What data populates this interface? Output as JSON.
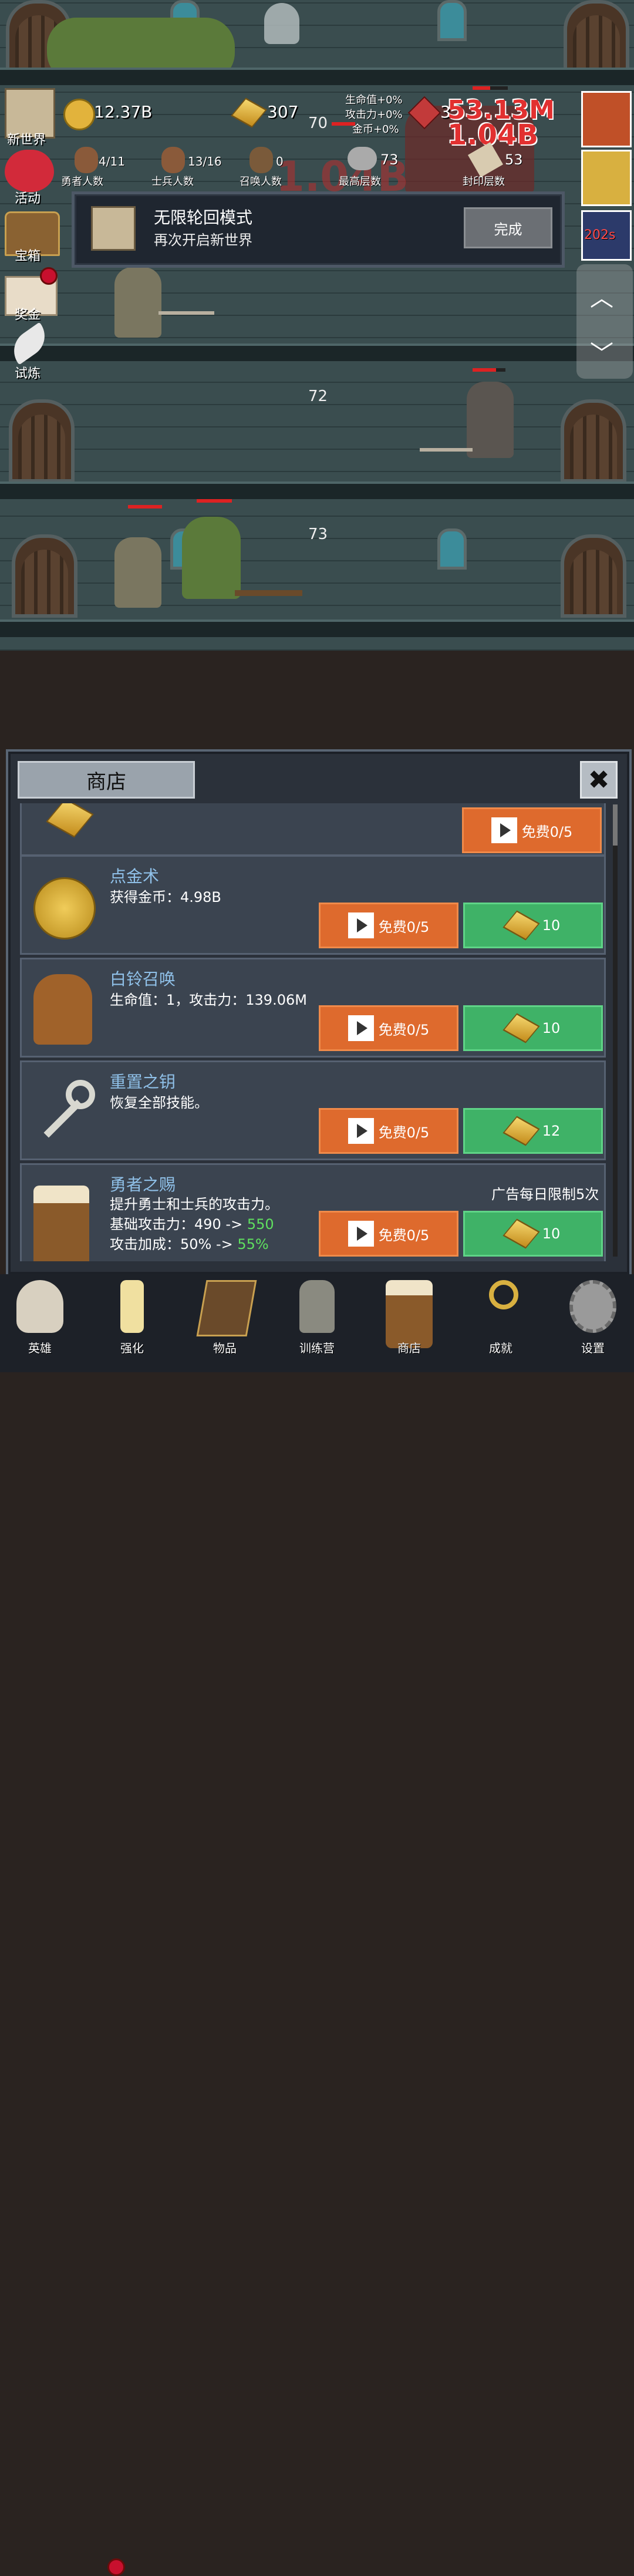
{
  "hud": {
    "coins": "12.37B",
    "gold": "307",
    "gems": "3",
    "buffs": [
      "生命值+0%",
      "攻击力+0%",
      "金币+0%"
    ],
    "heroes": {
      "value": "4/11",
      "label": "勇者人数"
    },
    "soldiers": {
      "value": "13/16",
      "label": "士兵人数"
    },
    "summons": {
      "value": "0",
      "label": "召唤人数"
    },
    "max_floor": {
      "value": "73",
      "label": "最高层数"
    },
    "sealed_floor": {
      "value": "53",
      "label": "封印层数"
    },
    "damage_text_1": "53.13M",
    "damage_text_2": "1.04B",
    "timer": "202s"
  },
  "side_menu": [
    "新世界",
    "活动",
    "宝箱",
    "奖金",
    "试炼"
  ],
  "floors": [
    "70",
    "72",
    "73"
  ],
  "quest": {
    "title": "无限轮回模式",
    "subtitle": "再次开启新世界",
    "button": "完成"
  },
  "shop": {
    "title": "商店",
    "close": "✖",
    "top_item_button": "免费0/5",
    "items": [
      {
        "name": "点金术",
        "desc": [
          "获得金币：4.98B"
        ],
        "ad_button": "免费0/5",
        "price": "10"
      },
      {
        "name": "白铃召唤",
        "desc": [
          "生命值：1，攻击力：139.06M"
        ],
        "ad_button": "免费0/5",
        "price": "10"
      },
      {
        "name": "重置之钥",
        "desc": [
          "恢复全部技能。"
        ],
        "ad_button": "免费0/5",
        "price": "12"
      },
      {
        "name": "勇者之赐",
        "note": "广告每日限制5次",
        "desc": [
          "提升勇士和士兵的攻击力。"
        ],
        "attack_prefix": "基础攻击力：490 -> ",
        "attack_new": "550",
        "bonus_prefix": "攻击加成：50% -> ",
        "bonus_new": "55%",
        "ad_button": "免费0/5",
        "price": "10"
      }
    ]
  },
  "nav": [
    "英雄",
    "强化",
    "物品",
    "训练营",
    "商店",
    "成就",
    "设置"
  ],
  "colors": {
    "orange": "#de6a2d",
    "green": "#3fb267",
    "item_name": "#8fc0e8",
    "upgrade_green": "#5fe05f"
  }
}
